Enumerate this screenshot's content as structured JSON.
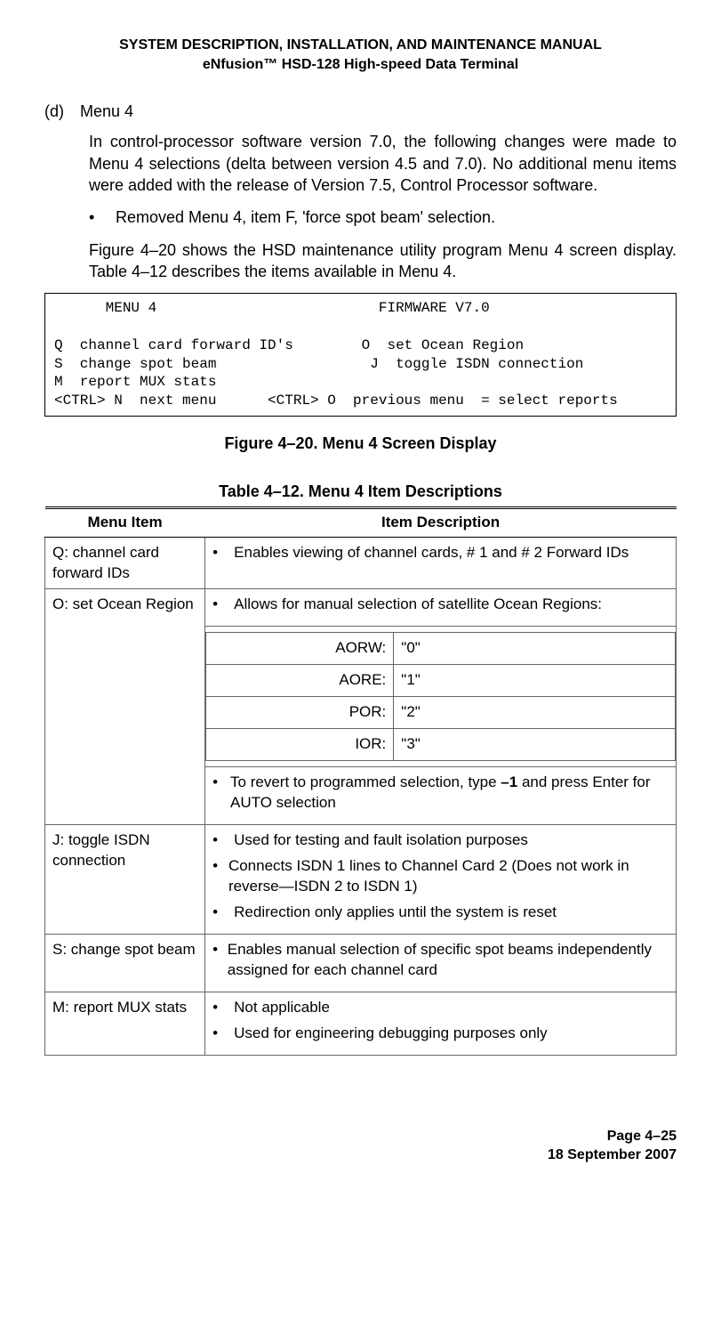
{
  "header": {
    "line1": "SYSTEM DESCRIPTION, INSTALLATION, AND MAINTENANCE MANUAL",
    "line2": "eNfusion™ HSD-128 High-speed Data Terminal"
  },
  "section": {
    "tag": "(d)",
    "title": "Menu 4",
    "para1": "In control-processor software version 7.0, the following changes were made to Menu 4 selections (delta between version 4.5 and 7.0). No additional menu items were added with the release of Version 7.5, Control Processor software.",
    "bullet1": "Removed Menu 4, item F, 'force spot beam' selection.",
    "para2": "Figure 4–20 shows the HSD maintenance utility program Menu 4 screen display. Table 4–12 describes the items available in Menu 4."
  },
  "menu_box": "      MENU 4                          FIRMWARE V7.0\n\nQ  channel card forward ID's        O  set Ocean Region\nS  change spot beam                  J  toggle ISDN connection\nM  report MUX stats\n<CTRL> N  next menu      <CTRL> O  previous menu  = select reports",
  "figure_caption": "Figure 4–20. Menu 4 Screen Display",
  "table_caption": "Table 4–12. Menu 4 Item Descriptions",
  "table": {
    "headers": [
      "Menu Item",
      "Item Description"
    ],
    "rows": {
      "q": {
        "item": "Q: channel card forward IDs",
        "desc": "Enables viewing of channel cards, # 1 and # 2 Forward IDs"
      },
      "o": {
        "item": "O: set Ocean Region",
        "desc_top": "Allows for manual selection of satellite Ocean Regions:",
        "regions": [
          {
            "label": "AORW:",
            "val": "\"0\""
          },
          {
            "label": "AORE:",
            "val": "\"1\""
          },
          {
            "label": "POR:",
            "val": "\"2\""
          },
          {
            "label": "IOR:",
            "val": "\"3\""
          }
        ],
        "desc_bottom_prefix": "To revert to programmed selection, type ",
        "desc_bottom_bold": "–1",
        "desc_bottom_suffix": " and press Enter for AUTO selection"
      },
      "j": {
        "item": "J: toggle ISDN connection",
        "b1": "Used for testing and fault isolation purposes",
        "b2": "Connects ISDN 1 lines to Channel Card 2 (Does not work in reverse—ISDN 2 to ISDN 1)",
        "b3": "Redirection only applies until the system is reset"
      },
      "s": {
        "item": "S: change spot beam",
        "desc": "Enables manual selection of specific spot beams independently assigned for each channel card"
      },
      "m": {
        "item": "M: report MUX stats",
        "b1": "Not applicable",
        "b2": "Used for engineering debugging purposes only"
      }
    }
  },
  "footer": {
    "page": "Page 4–25",
    "date": "18 September 2007"
  }
}
